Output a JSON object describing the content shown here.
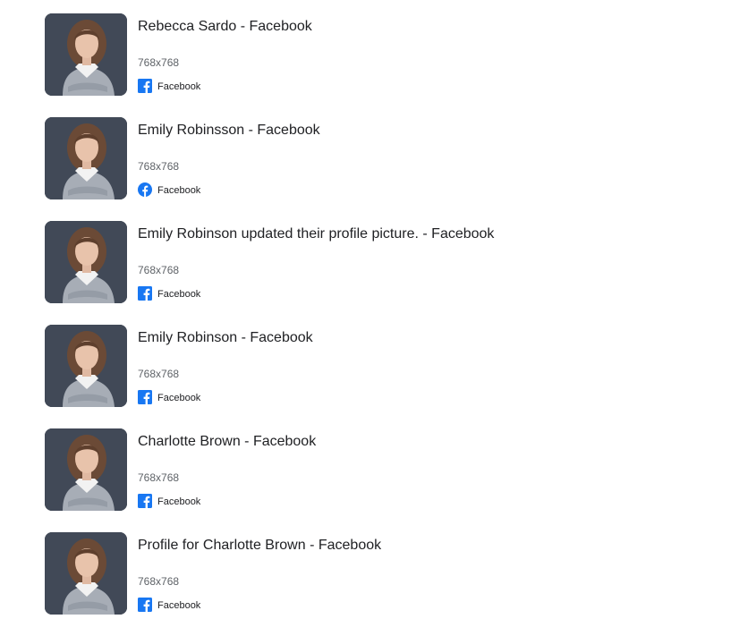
{
  "results": [
    {
      "title": "Rebecca Sardo - Facebook",
      "dimensions": "768x768",
      "source": "Facebook",
      "source_icon": "facebook-square-icon"
    },
    {
      "title": "Emily Robinsson - Facebook",
      "dimensions": "768x768",
      "source": "Facebook",
      "source_icon": "facebook-circle-icon"
    },
    {
      "title": "Emily Robinson updated their profile picture. - Facebook",
      "dimensions": "768x768",
      "source": "Facebook",
      "source_icon": "facebook-square-icon"
    },
    {
      "title": "Emily Robinson - Facebook",
      "dimensions": "768x768",
      "source": "Facebook",
      "source_icon": "facebook-square-icon"
    },
    {
      "title": "Charlotte Brown - Facebook",
      "dimensions": "768x768",
      "source": "Facebook",
      "source_icon": "facebook-square-icon"
    },
    {
      "title": "Profile for Charlotte Brown - Facebook",
      "dimensions": "768x768",
      "source": "Facebook",
      "source_icon": "facebook-square-icon"
    }
  ],
  "colors": {
    "facebook_blue": "#1877F2",
    "title_text": "#202124",
    "meta_text": "#5f6368",
    "thumb_background": "#3b4350"
  }
}
